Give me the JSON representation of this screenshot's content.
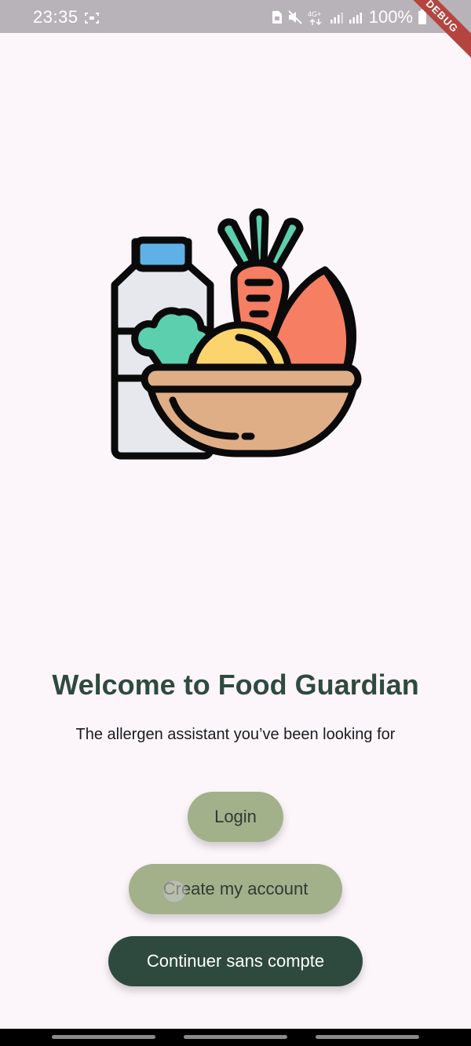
{
  "status_bar": {
    "time": "23:35",
    "network": "4G+",
    "battery": "100%",
    "icons": [
      "screen-record-icon",
      "sim-icon",
      "mute-icon",
      "network-4g-icon",
      "signal-icon",
      "signal-icon",
      "battery-icon"
    ]
  },
  "debug_banner": "DEBUG",
  "hero": {
    "icon": "groceries-bowl-illustration",
    "colors": {
      "outline": "#0a0a0a",
      "bottle": "#e6e8ee",
      "cap": "#5eb0e6",
      "carrot": "#f57e63",
      "leaves": "#5ccfae",
      "squash": "#fbd46d",
      "bowl": "#dfae87"
    }
  },
  "welcome": {
    "title": "Welcome to Food Guardian",
    "subtitle": "The allergen assistant you’ve been looking for"
  },
  "actions": {
    "login": "Login",
    "create_account": "Create my account",
    "continue_guest": "Continuer sans compte"
  },
  "colors": {
    "background": "#fcf6fa",
    "primary": "#2e4a3e",
    "secondary": "#a2b18a",
    "title": "#2f4a3e"
  }
}
